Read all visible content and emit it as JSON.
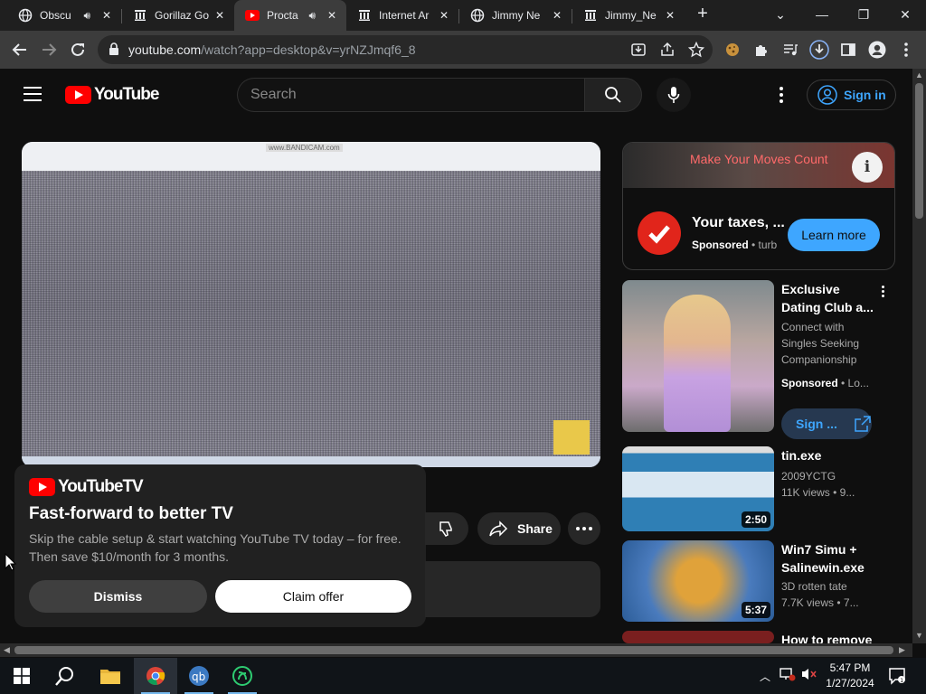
{
  "browser": {
    "tabs": [
      {
        "title": "Obscu",
        "audio": true,
        "active": false,
        "favicon": "globe-icon"
      },
      {
        "title": "Gorillaz Go",
        "audio": false,
        "active": false,
        "favicon": "archive-icon"
      },
      {
        "title": "Procta",
        "audio": true,
        "active": true,
        "favicon": "youtube-icon"
      },
      {
        "title": "Internet Ar",
        "audio": false,
        "active": false,
        "favicon": "archive-icon"
      },
      {
        "title": "Jimmy Ne",
        "audio": false,
        "active": false,
        "favicon": "globe-icon"
      },
      {
        "title": "Jimmy_Ne",
        "audio": false,
        "active": false,
        "favicon": "archive-icon"
      }
    ],
    "url_host": "youtube.com",
    "url_path": "/watch?app=desktop&v=yrNZJmqf6_8"
  },
  "youtube": {
    "logo_text": "YouTube",
    "search_placeholder": "Search",
    "signin_label": "Sign in",
    "video_watermark": "www.BANDICAM.com",
    "promo": {
      "logo_text": "YouTubeTV",
      "title": "Fast-forward to better TV",
      "body": "Skip the cable setup & start watching YouTube TV today – for free. Then save $10/month for 3 months.",
      "dismiss_label": "Dismiss",
      "claim_label": "Claim offer"
    },
    "share_label": "Share",
    "sidebar": {
      "ad": {
        "banner_text": "Make Your Moves Count",
        "title": "Your taxes, ...",
        "sponsored": "Sponsored",
        "advertiser": "turb",
        "cta": "Learn more"
      },
      "items": [
        {
          "title": "Exclusive Dating Club a...",
          "line1": "Connect with",
          "line2": "Singles Seeking",
          "line3": "Companionship",
          "sponsored": "Sponsored",
          "advertiser": "Lo...",
          "cta": "Sign ..."
        },
        {
          "title": "tin.exe",
          "channel": "2009YCTG",
          "meta": "11K views • 9...",
          "duration": "2:50"
        },
        {
          "title": "Win7 Simu + Salinewin.exe",
          "channel": "3D rotten tate",
          "meta": "7.7K views • 7...",
          "duration": "5:37"
        },
        {
          "title": "How to remove"
        }
      ]
    }
  },
  "taskbar": {
    "time": "5:47 PM",
    "date": "1/27/2024"
  },
  "colors": {
    "youtube_red": "#ff0000",
    "link_blue": "#3ea6ff",
    "page_bg": "#0f0f0f"
  }
}
